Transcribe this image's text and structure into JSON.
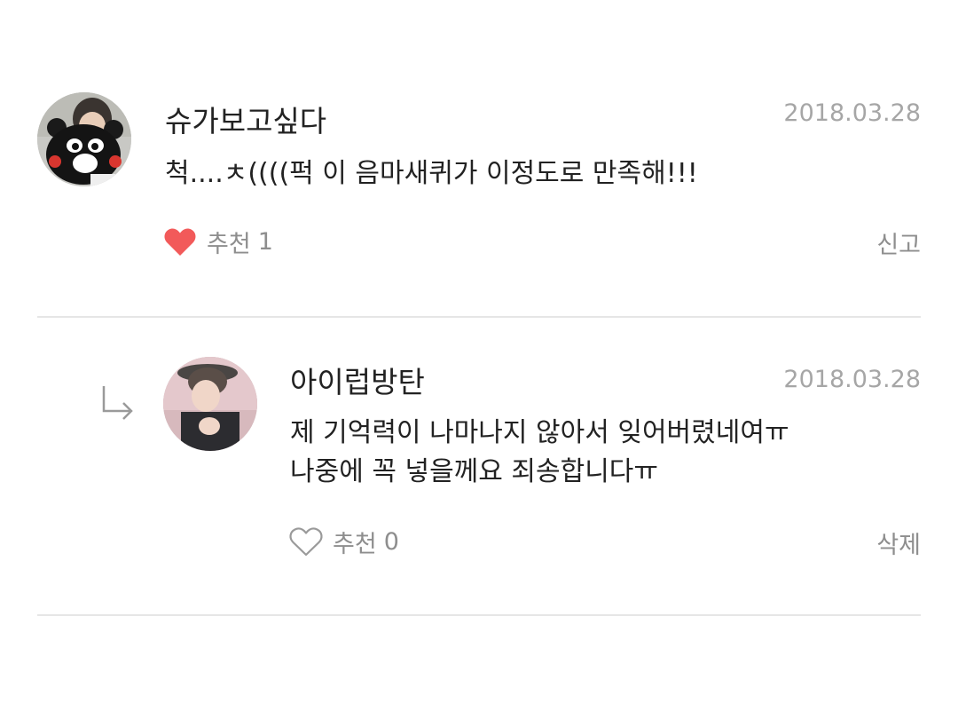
{
  "comments": [
    {
      "username": "슈가보고싶다",
      "date": "2018.03.28",
      "text": [
        "척....ㅊ((((퍽 이 음마새퀴가 이정도로 만족해!!!"
      ],
      "like_label": "추천",
      "like_count": "1",
      "liked": true,
      "action": "신고"
    },
    {
      "username": "아이럽방탄",
      "date": "2018.03.28",
      "text": [
        "제 기억력이 나마나지 않아서 잊어버렸네여ㅠ",
        "나중에 꼭 넣을께요 죄송합니다ㅠ"
      ],
      "like_label": "추천",
      "like_count": "0",
      "liked": false,
      "action": "삭제",
      "is_reply": true
    }
  ],
  "colors": {
    "heart_filled": "#f25a5a",
    "heart_outline": "#9a9a9a",
    "muted_text": "#8e8e8e",
    "date_text": "#a6a6a6",
    "divider": "#e6e6e6"
  },
  "icons": {
    "liked_heart": "heart-filled-icon",
    "unliked_heart": "heart-outline-icon",
    "reply": "reply-arrow-icon"
  }
}
